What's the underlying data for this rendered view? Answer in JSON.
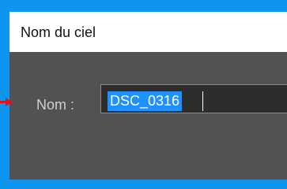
{
  "dialog": {
    "title": "Nom du ciel",
    "field_label": "Nom :",
    "field_value": "DSC_0316"
  },
  "colors": {
    "outer_background": "#0f95ee",
    "dialog_body": "#525252",
    "titlebar": "#ffffff",
    "input_background": "#2d2d2d",
    "selection_highlight": "#1e90ff",
    "pointer_arrow": "#e8111a"
  },
  "icons": {
    "pointer": "red-arrow-icon"
  }
}
